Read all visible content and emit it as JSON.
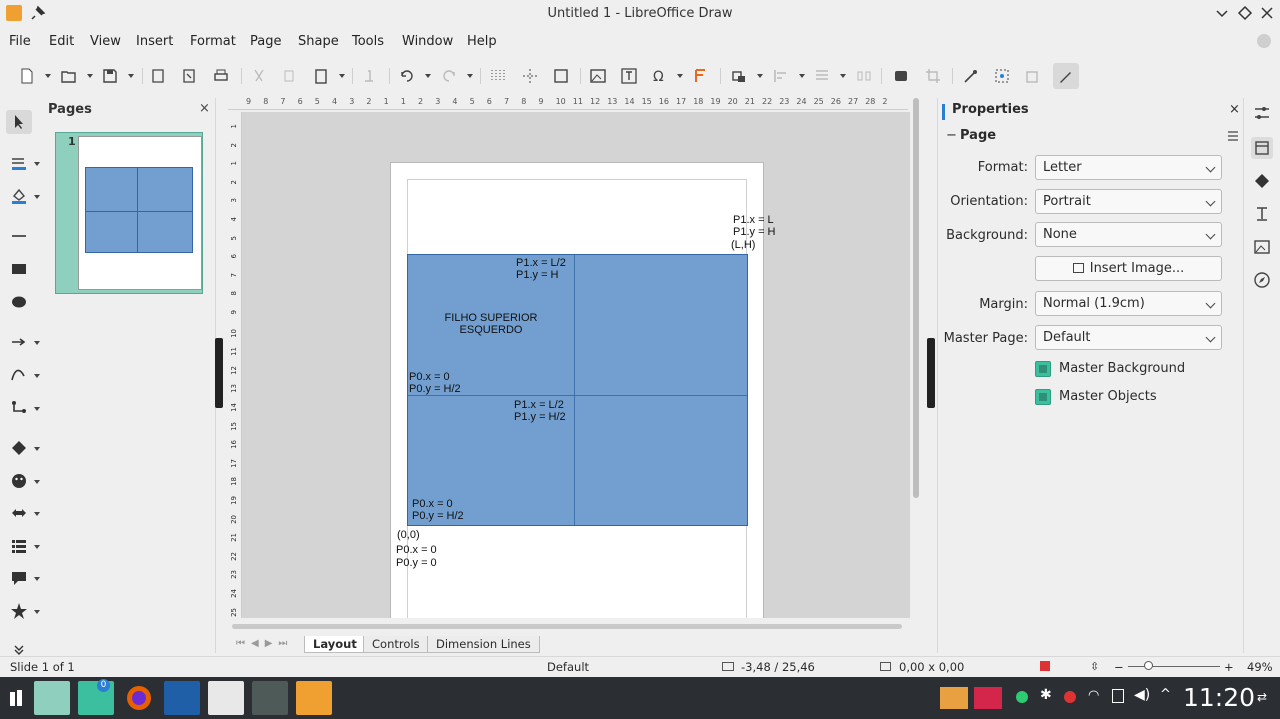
{
  "window": {
    "title": "Untitled 1 - LibreOffice Draw"
  },
  "menu": [
    "File",
    "Edit",
    "View",
    "Insert",
    "Format",
    "Page",
    "Shape",
    "Tools",
    "Window",
    "Help"
  ],
  "pages_panel": {
    "title": "Pages",
    "page_number": "1"
  },
  "canvas": {
    "labels": {
      "top_right_1": "P1.x = L",
      "top_right_2": "P1.y = H",
      "top_right_3": "(L,H)",
      "tl_p1x": "P1.x = L/2",
      "tl_p1y": "P1.y = H",
      "tl_title_1": "FILHO SUPERIOR",
      "tl_title_2": "ESQUERDO",
      "tl_p0x": "P0.x = 0",
      "tl_p0y": "P0.y = H/2",
      "bl_p1x": "P1.x = L/2",
      "bl_p1y": "P1.y = H/2",
      "bl_p0x": "P0.x = 0",
      "bl_p0y": "P0.y = H/2",
      "origin": "(0,0)",
      "origin_p0x": "P0.x = 0",
      "origin_p0y": "P0.y = 0"
    },
    "fill_color": "#729fcf"
  },
  "ruler": {
    "h_ticks": [
      "9",
      "8",
      "7",
      "6",
      "5",
      "4",
      "3",
      "2",
      "1",
      "1",
      "2",
      "3",
      "4",
      "5",
      "6",
      "7",
      "8",
      "9",
      "10",
      "11",
      "12",
      "13",
      "14",
      "15",
      "16",
      "17",
      "18",
      "19",
      "20",
      "21",
      "22",
      "23",
      "24",
      "25",
      "26",
      "27",
      "28",
      "2"
    ],
    "v_ticks": [
      "1",
      "2",
      "1",
      "2",
      "3",
      "4",
      "5",
      "6",
      "7",
      "8",
      "9",
      "10",
      "11",
      "12",
      "13",
      "14",
      "15",
      "16",
      "17",
      "18",
      "19",
      "20",
      "21",
      "22",
      "23",
      "24",
      "25"
    ]
  },
  "tabs": [
    "Layout",
    "Controls",
    "Dimension Lines"
  ],
  "properties": {
    "title": "Properties",
    "section": "Page",
    "format_label": "Format:",
    "format_value": "Letter",
    "orientation_label": "Orientation:",
    "orientation_value": "Portrait",
    "background_label": "Background:",
    "background_value": "None",
    "insert_image": "Insert Image...",
    "margin_label": "Margin:",
    "margin_value": "Normal (1.9cm)",
    "master_page_label": "Master Page:",
    "master_page_value": "Default",
    "master_background": "Master Background",
    "master_objects": "Master Objects"
  },
  "statusbar": {
    "slide": "Slide 1 of 1",
    "master": "Default",
    "position": "-3,48 / 25,46",
    "size": "0,00 x 0,00",
    "zoom": "49%"
  },
  "taskbar": {
    "clock": "11:20",
    "badge": "0"
  }
}
